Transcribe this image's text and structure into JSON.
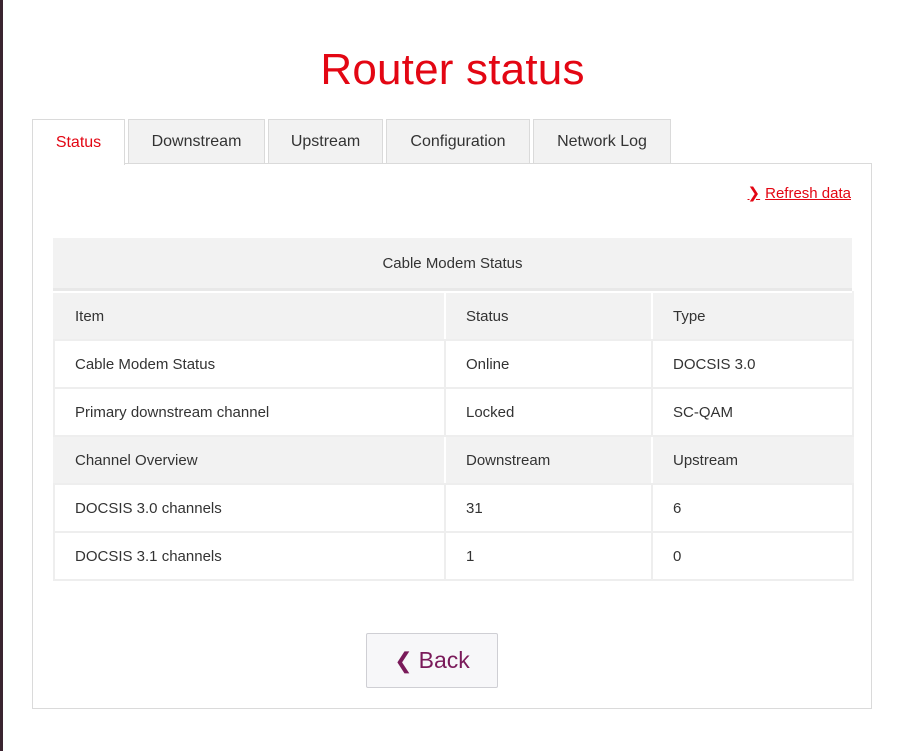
{
  "page": {
    "title": "Router status"
  },
  "tabs": [
    {
      "label": "Status",
      "active": true
    },
    {
      "label": "Downstream",
      "active": false
    },
    {
      "label": "Upstream",
      "active": false
    },
    {
      "label": "Configuration",
      "active": false
    },
    {
      "label": "Network Log",
      "active": false
    }
  ],
  "refresh": {
    "label": "Refresh data",
    "icon": "chevron-right-icon"
  },
  "status_table": {
    "title": "Cable Modem Status",
    "header": [
      "Item",
      "Status",
      "Type"
    ],
    "rows": [
      [
        "Cable Modem Status",
        "Online",
        "DOCSIS 3.0"
      ],
      [
        "Primary downstream channel",
        "Locked",
        "SC-QAM"
      ]
    ],
    "sub_header": [
      "Channel Overview",
      "Downstream",
      "Upstream"
    ],
    "channel_rows": [
      [
        "DOCSIS 3.0 channels",
        "31",
        "6"
      ],
      [
        "DOCSIS 3.1 channels",
        "1",
        "0"
      ]
    ]
  },
  "back_button": {
    "label": "Back",
    "icon": "chevron-left-icon"
  },
  "colors": {
    "accent": "#e30613",
    "back_text": "#7a1a5a",
    "tab_bg": "#f2f2f2"
  }
}
